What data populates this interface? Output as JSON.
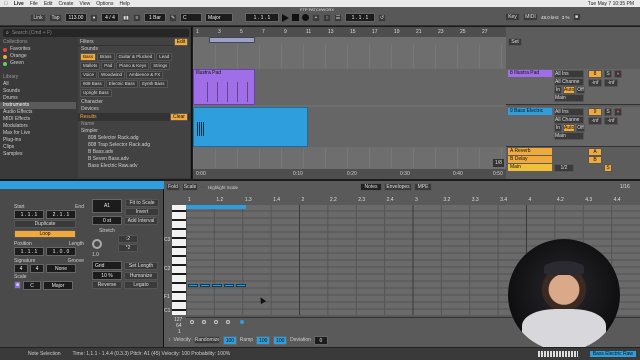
{
  "mac_menu": [
    "Live",
    "File",
    "Edit",
    "Create",
    "View",
    "Options",
    "Help"
  ],
  "mac_status": "Tue May 7 10:35 PM",
  "window_title": "FTP PATCHWORX",
  "transport": {
    "link": "Link",
    "tap": "Tap",
    "tempo": "113.00",
    "time_sig": "4 / 4",
    "quantize": "1 Bar",
    "key": "C",
    "scale": "Major",
    "position": "1 . 1 . 1",
    "loop_start": "1 . 1 . 1",
    "key_btn": "Key",
    "midi_btn": "MIDI",
    "sample_rate": "48.0 kHz",
    "cpu": "3 %"
  },
  "browser": {
    "search_placeholder": "Search (Cmd + F)",
    "collections_label": "Collections",
    "collections": [
      "Favorites",
      "Orange",
      "Green"
    ],
    "library_label": "Library",
    "library": [
      "All",
      "Sounds",
      "Drums",
      "Instruments",
      "Audio Effects",
      "MIDI Effects",
      "Modulators",
      "Max for Live",
      "Plug-ins",
      "Clips",
      "Samples"
    ],
    "filters_label": "Filters",
    "edit_btn": "Edit",
    "sounds_label": "Sounds",
    "sound_tags": [
      "Bass",
      "Brass",
      "Guitar & Plucked",
      "Lead",
      "Mallets",
      "Pad",
      "Piano & Keys",
      "Strings",
      "Voice",
      "Woodwind",
      "Ambience & FX",
      "808 Bass",
      "Electric Bass",
      "Synth Bass",
      "Upright Bass"
    ],
    "character_label": "Character",
    "devices_label": "Devices",
    "results_label": "Results",
    "clear_btn": "Clear",
    "name_col": "Name",
    "results": [
      "Simpler",
      "808 Selector Rack.adg",
      "808 Trap Selector Rack.adg",
      "B Bass.adv",
      "B Seven Bass.adv",
      "Bass Electric Raw.adv"
    ]
  },
  "arrangement": {
    "ruler": [
      "1",
      "3",
      "5",
      "7",
      "9",
      "11",
      "13",
      "15",
      "17",
      "19",
      "21",
      "23",
      "25",
      "27"
    ],
    "time_marks": [
      "0:00",
      "0:10",
      "0:20",
      "0:30",
      "0:40",
      "0:50"
    ],
    "tracks": [
      {
        "name": "Illustra Pad",
        "color": "#a06ee6"
      },
      {
        "name": "Bass Electric",
        "color": "#2e9fdc"
      }
    ],
    "fraction": "1/8"
  },
  "mixer": {
    "set_label": "Set",
    "tracks": [
      {
        "num": "8",
        "name": "8 Illustra Pad",
        "input": "All Ins",
        "channel": "All Channe",
        "monitor": "In",
        "auto": "Auto",
        "off": "Off",
        "routing": "Main",
        "vol": "-inf",
        "pan": "-inf",
        "color": "#f0a93a"
      },
      {
        "num": "9",
        "name": "9 Bass Electric",
        "input": "All Ins",
        "channel": "All Channe",
        "monitor": "In",
        "auto": "Auto",
        "off": "Off",
        "routing": "Main",
        "vol": "-inf",
        "pan": "-inf",
        "color": "#f0a93a"
      }
    ],
    "returns": [
      {
        "letter": "A",
        "name": "A Reverb"
      },
      {
        "letter": "B",
        "name": "B Delay"
      }
    ],
    "main": {
      "name": "Main",
      "value": "1/2",
      "solo": "S",
      "post": "Post"
    }
  },
  "clip": {
    "start_label": "Start",
    "end_label": "End",
    "start": "1 . 1 . 1",
    "end": "2 . 1 . 1",
    "duplicate": "Duplicate",
    "loop": "Loop",
    "position_label": "Position",
    "length_label": "Length",
    "position": "1 . 1 . 1",
    "length": "1 . 0 . 0",
    "signature_label": "Signature",
    "groove_label": "Groove",
    "sig_num": "4",
    "sig_den": "4",
    "groove": "None",
    "scale_label": "Scale",
    "scale_key": "C",
    "scale_name": "Major",
    "note_name": "A1",
    "fit": "Fit to Scale",
    "invert": "Invert",
    "st": "0 st",
    "add_interval": "Add Interval",
    "stretch": "Stretch",
    "half": ":2",
    "double": "*2",
    "stretch_val": "1.0",
    "grid": "Grid",
    "set_length": "Set Length",
    "percent": "10 %",
    "humanize": "Humanize",
    "reverse": "Reverse",
    "legato": "Legato"
  },
  "editor": {
    "fold": "Fold",
    "scale_btn": "Scale",
    "highlight": "Highlight Scale",
    "tabs": [
      "Notes",
      "Envelopes",
      "MPE"
    ],
    "fraction": "1/16",
    "ruler": [
      "1",
      "1.2",
      "1.3",
      "1.4",
      "2",
      "2.2",
      "2.3",
      "2.4",
      "3",
      "3.2",
      "3.3",
      "3.4",
      "4",
      "4.2",
      "4.3",
      "4.4"
    ],
    "keys": [
      "C3",
      "C2",
      "F1",
      "C1"
    ],
    "vel_values": [
      "127",
      "64",
      "1"
    ],
    "footer": {
      "velocity": "Velocity",
      "randomize": "Randomize",
      "ramp": "Ramp",
      "deviation": "Deviation",
      "vel_val": "100",
      "ramp_val": "100",
      "dev_val": "0"
    }
  },
  "status": {
    "selection": "Note Selection",
    "info": "Time: 1.1.1 - 1.4.4 (0.3.3)  Pitch: A1 (45)  Velocity: 100  Probability: 100%",
    "bass_label": "Bass Electric Raw"
  }
}
